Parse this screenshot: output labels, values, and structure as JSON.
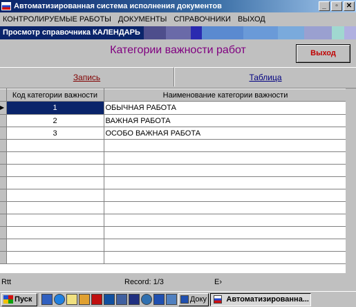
{
  "window": {
    "title": "Автоматизированная система исполнения документов",
    "buttons": [
      "_",
      "▫",
      "✕"
    ]
  },
  "menu": [
    "КОНТРОЛИРУЕМЫЕ РАБОТЫ",
    "ДОКУМЕНТЫ",
    "СПРАВОЧНИКИ",
    "ВЫХОД"
  ],
  "subcaption": "Просмотр справочника КАЛЕНДАРЬ",
  "stripe_colors": [
    "#4e4e8c",
    "#6a6aa8",
    "#2a2ab0",
    "#5a8ad0",
    "#6a9ad8",
    "#7aaadc",
    "#9aa0d0",
    "#a0d8d0",
    "#b0b0e0"
  ],
  "form": {
    "title": "Категории важности работ",
    "exit_label": "Выход"
  },
  "tabs": {
    "record": "Запись",
    "table": "Таблица"
  },
  "grid": {
    "columns": [
      "Код категории важности",
      "Наименование категории важности"
    ],
    "rows": [
      {
        "code": "1",
        "name": "ОБЫЧНАЯ РАБОТА"
      },
      {
        "code": "2",
        "name": "ВАЖНАЯ РАБОТА"
      },
      {
        "code": "3",
        "name": "ОСОБО ВАЖНАЯ РАБОТА"
      }
    ]
  },
  "status": {
    "left": "Rtt",
    "record": "Record: 1/3",
    "right": "E›"
  },
  "taskbar": {
    "start": "Пуск",
    "doc_task": "Доку",
    "app_task": "Автоматизированна..."
  }
}
